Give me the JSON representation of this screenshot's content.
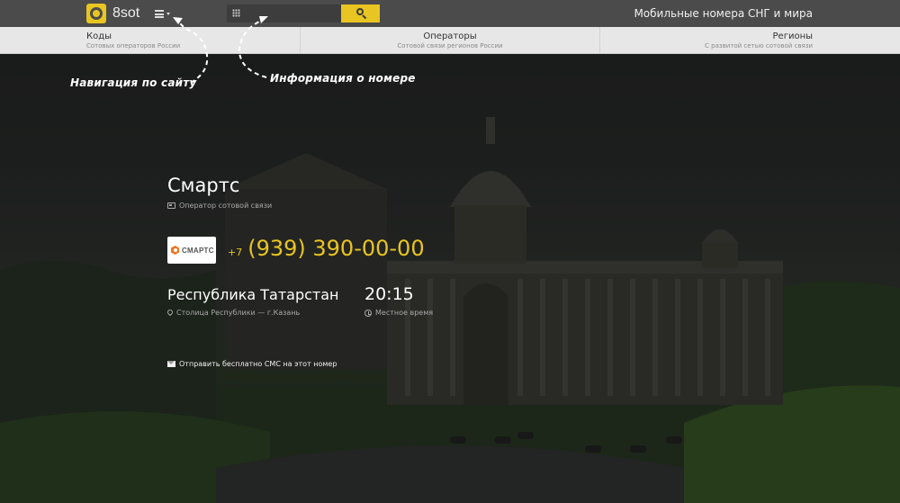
{
  "header": {
    "logo_text": "8sot",
    "search": {
      "placeholder": ""
    },
    "tagline": "Мобильные номера СНГ и мира"
  },
  "subnav": [
    {
      "title": "Коды",
      "subtitle": "Сотовых операторов России"
    },
    {
      "title": "Операторы",
      "subtitle": "Сотовой связи регионов России"
    },
    {
      "title": "Регионы",
      "subtitle": "С развитой сетью сотовой связи"
    }
  ],
  "hints": {
    "navigation": "Навигация по сайту",
    "number_info": "Информация о номере"
  },
  "operator": {
    "name": "Смартс",
    "type": "Оператор сотовой связи",
    "logo_text": "СМАРТС",
    "brand_color": "#ee7520"
  },
  "phone": {
    "prefix": "+7",
    "number": "(939) 390-00-00"
  },
  "region": {
    "name": "Республика Татарстан",
    "capital": "Столица Республики — г.Казань"
  },
  "time": {
    "value": "20:15",
    "label": "Местное время"
  },
  "sms_link": "Отправить бесплатно СМС на этот номер",
  "colors": {
    "accent": "#e8c521",
    "topbar": "#4b4b4b",
    "subnav": "#e7e7e7"
  }
}
